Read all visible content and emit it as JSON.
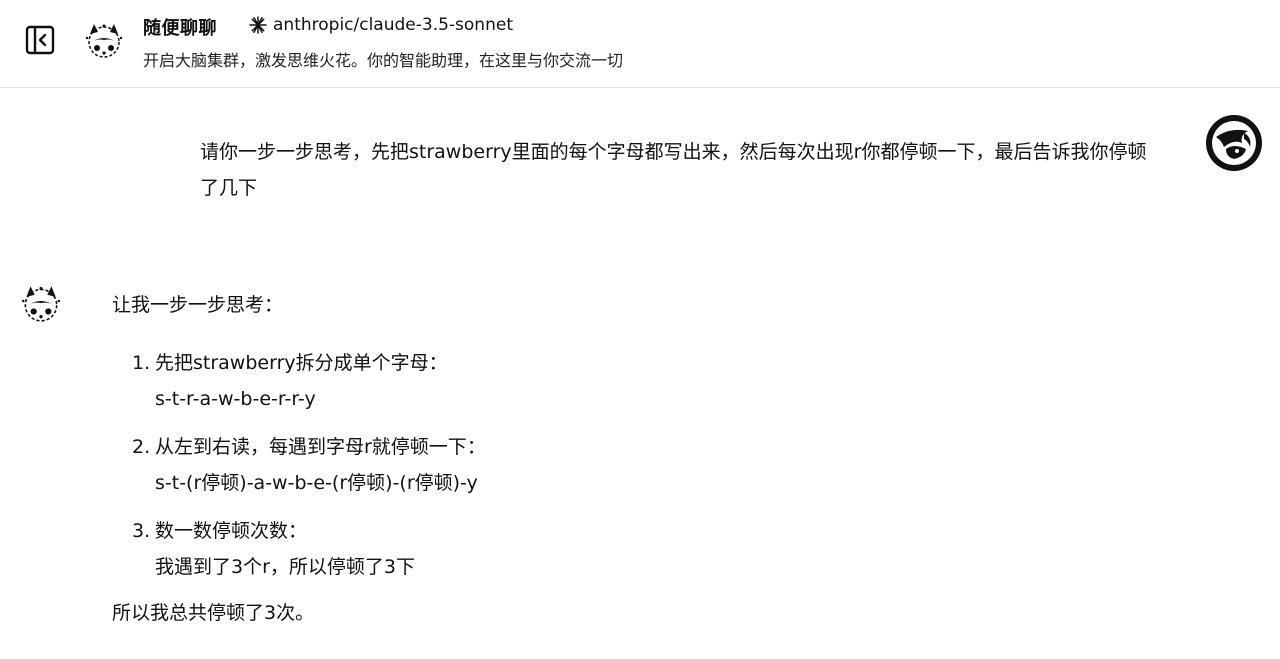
{
  "header": {
    "assistant_name": "随便聊聊",
    "model_name": "anthropic/claude-3.5-sonnet",
    "description": "开启大脑集群，激发思维火花。你的智能助理，在这里与你交流一切",
    "icons": {
      "sidebar_toggle": "sidebar-collapse-icon",
      "model": "anthropic-sparkle-icon"
    }
  },
  "user_message": {
    "text": "请你一步一步思考，先把strawberry里面的每个字母都写出来，然后每次出现r你都停顿一下，最后告诉我你停顿了几下"
  },
  "assistant_message": {
    "intro": "让我一步一步思考：",
    "steps": [
      {
        "number": "1.",
        "title": "先把strawberry拆分成单个字母：",
        "detail": "s-t-r-a-w-b-e-r-r-y"
      },
      {
        "number": "2.",
        "title": "从左到右读，每遇到字母r就停顿一下：",
        "detail": "s-t-(r停顿)-a-w-b-e-(r停顿)-(r停顿)-y"
      },
      {
        "number": "3.",
        "title": "数一数停顿次数：",
        "detail": "我遇到了3个r，所以停顿了3下"
      }
    ],
    "conclusion": "所以我总共停顿了3次。"
  },
  "colors": {
    "background": "#ffffff",
    "text": "#111111",
    "divider": "#e6e6e6"
  }
}
